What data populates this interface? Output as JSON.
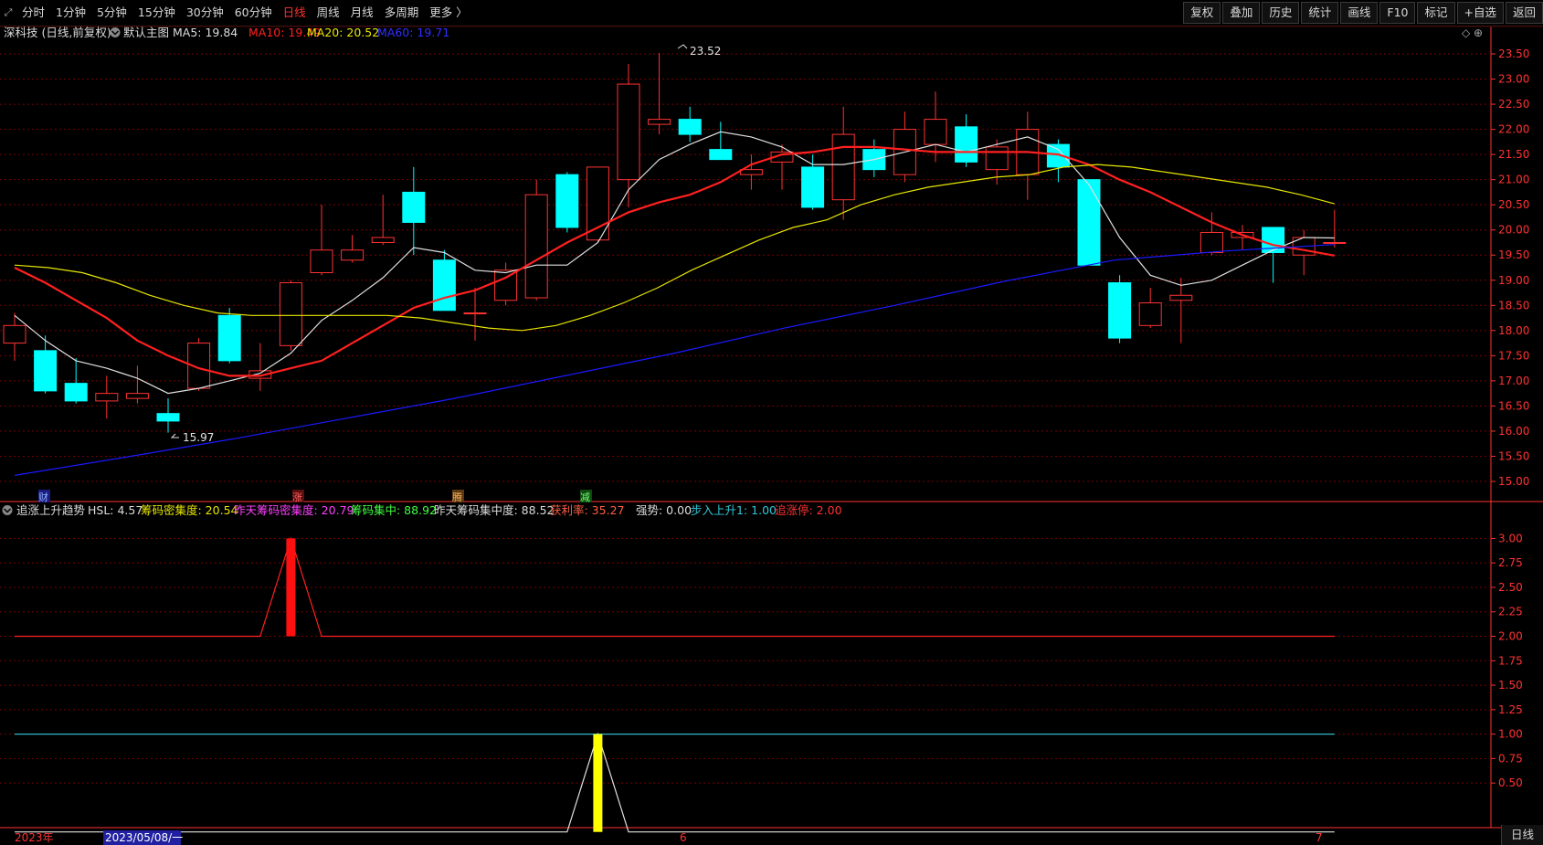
{
  "toolbar": {
    "left_items": [
      "分时",
      "1分钟",
      "5分钟",
      "15分钟",
      "30分钟",
      "60分钟",
      "日线",
      "周线",
      "月线",
      "多周期",
      "更多 〉"
    ],
    "active": "日线",
    "right_items": [
      "复权",
      "叠加",
      "历史",
      "统计",
      "画线",
      "F10",
      "标记",
      "+自选",
      "返回"
    ]
  },
  "main_header": {
    "stock": "深科技 (日线,前复权)",
    "chart_name": "默认主图",
    "ma5": "MA5: 19.84",
    "ma10": "MA10: 19.49",
    "ma20": "MA20: 20.52",
    "ma60": "MA60: 19.71",
    "right_icons": "◇ ⊕"
  },
  "sub_header": {
    "name": "追涨上升趋势",
    "hsl": "HSL: 4.57",
    "cmj": "筹码密集度: 20.54",
    "zt_cmj": "昨天筹码密集度: 20.79",
    "cmjz": "筹码集中: 88.92",
    "zt_cmjz": "昨天筹码集中度: 88.52",
    "hll": "获利率: 35.27",
    "qs": "强势: 0.00",
    "brss": "步入上升1: 1.00",
    "zzt": "追涨停: 2.00"
  },
  "markers": {
    "max_label": "23.52",
    "min_label": "15.97",
    "events": [
      "财",
      "涨",
      "腾",
      "减"
    ]
  },
  "x_labels": {
    "year": "2023年",
    "cursor_date": "2023/05/08/一",
    "m6": "6",
    "m7": "7"
  },
  "status": {
    "period": "日线"
  },
  "colors": {
    "up": "#ff3232",
    "down": "#00ffff",
    "ma5": "#e0e0e0",
    "ma10": "#ff2020",
    "ma20": "#e6e600",
    "ma60": "#1a1aff",
    "grid": "#7a0000",
    "axis": "#ff3232"
  },
  "chart_data": [
    {
      "type": "candlestick",
      "ylim": [
        14.8,
        23.7
      ],
      "y_ticks": [
        "23.50",
        "23.00",
        "22.50",
        "22.00",
        "21.50",
        "21.00",
        "20.50",
        "20.00",
        "19.50",
        "19.00",
        "18.50",
        "18.00",
        "17.50",
        "17.00",
        "16.50",
        "16.00",
        "15.50",
        "15.00"
      ],
      "candles": [
        {
          "o": 17.75,
          "h": 18.35,
          "l": 17.4,
          "c": 18.1
        },
        {
          "o": 17.6,
          "h": 17.9,
          "l": 16.75,
          "c": 16.8
        },
        {
          "o": 16.95,
          "h": 17.45,
          "l": 16.55,
          "c": 16.6
        },
        {
          "o": 16.6,
          "h": 17.1,
          "l": 16.25,
          "c": 16.75
        },
        {
          "o": 16.65,
          "h": 17.3,
          "l": 16.55,
          "c": 16.75
        },
        {
          "o": 16.35,
          "h": 16.65,
          "l": 15.97,
          "c": 16.2
        },
        {
          "o": 16.85,
          "h": 17.85,
          "l": 16.8,
          "c": 17.75
        },
        {
          "o": 18.3,
          "h": 18.45,
          "l": 17.35,
          "c": 17.4
        },
        {
          "o": 17.05,
          "h": 17.75,
          "l": 16.8,
          "c": 17.2
        },
        {
          "o": 17.7,
          "h": 19.0,
          "l": 17.6,
          "c": 18.95
        },
        {
          "o": 19.15,
          "h": 20.5,
          "l": 19.1,
          "c": 19.6
        },
        {
          "o": 19.4,
          "h": 19.9,
          "l": 19.35,
          "c": 19.6
        },
        {
          "o": 19.75,
          "h": 20.7,
          "l": 19.7,
          "c": 19.85
        },
        {
          "o": 20.75,
          "h": 21.25,
          "l": 19.5,
          "c": 20.15
        },
        {
          "o": 19.4,
          "h": 19.6,
          "l": 18.4,
          "c": 18.4
        },
        {
          "o": 18.35,
          "h": 18.85,
          "l": 17.8,
          "c": 18.35
        },
        {
          "o": 18.6,
          "h": 19.35,
          "l": 18.5,
          "c": 19.2
        },
        {
          "o": 18.65,
          "h": 21.0,
          "l": 18.6,
          "c": 20.7
        },
        {
          "o": 21.1,
          "h": 21.15,
          "l": 19.95,
          "c": 20.05
        },
        {
          "o": 19.8,
          "h": 21.25,
          "l": 19.75,
          "c": 21.25
        },
        {
          "o": 21.0,
          "h": 23.3,
          "l": 20.45,
          "c": 22.9
        },
        {
          "o": 22.1,
          "h": 23.52,
          "l": 21.9,
          "c": 22.2
        },
        {
          "o": 22.2,
          "h": 22.45,
          "l": 21.75,
          "c": 21.9
        },
        {
          "o": 21.6,
          "h": 22.15,
          "l": 21.4,
          "c": 21.4
        },
        {
          "o": 21.1,
          "h": 21.5,
          "l": 20.8,
          "c": 21.2
        },
        {
          "o": 21.35,
          "h": 21.7,
          "l": 20.8,
          "c": 21.55
        },
        {
          "o": 21.25,
          "h": 21.5,
          "l": 20.4,
          "c": 20.45
        },
        {
          "o": 20.6,
          "h": 22.45,
          "l": 20.2,
          "c": 21.9
        },
        {
          "o": 21.6,
          "h": 21.8,
          "l": 21.05,
          "c": 21.2
        },
        {
          "o": 21.1,
          "h": 22.35,
          "l": 20.95,
          "c": 22.0
        },
        {
          "o": 21.7,
          "h": 22.75,
          "l": 21.35,
          "c": 22.2
        },
        {
          "o": 22.05,
          "h": 22.3,
          "l": 21.25,
          "c": 21.35
        },
        {
          "o": 21.2,
          "h": 21.8,
          "l": 20.9,
          "c": 21.65
        },
        {
          "o": 21.1,
          "h": 22.35,
          "l": 20.6,
          "c": 22.0
        },
        {
          "o": 21.7,
          "h": 21.8,
          "l": 20.95,
          "c": 21.25
        },
        {
          "o": 21.0,
          "h": 21.0,
          "l": 19.3,
          "c": 19.3
        },
        {
          "o": 18.95,
          "h": 19.1,
          "l": 17.75,
          "c": 17.85
        },
        {
          "o": 18.1,
          "h": 18.85,
          "l": 18.05,
          "c": 18.55
        },
        {
          "o": 18.6,
          "h": 19.05,
          "l": 17.75,
          "c": 18.7
        },
        {
          "o": 19.55,
          "h": 20.35,
          "l": 19.5,
          "c": 19.95
        },
        {
          "o": 19.85,
          "h": 20.1,
          "l": 19.6,
          "c": 19.95
        },
        {
          "o": 20.05,
          "h": 20.05,
          "l": 18.95,
          "c": 19.55
        },
        {
          "o": 19.5,
          "h": 20.0,
          "l": 19.1,
          "c": 19.85
        },
        {
          "o": 19.75,
          "h": 20.4,
          "l": 19.65,
          "c": 19.75
        }
      ],
      "series": [
        {
          "name": "MA5",
          "values": [
            18.3,
            17.8,
            17.4,
            17.25,
            17.05,
            16.75,
            16.85,
            17.0,
            17.15,
            17.55,
            18.2,
            18.6,
            19.05,
            19.65,
            19.55,
            19.2,
            19.15,
            19.3,
            19.3,
            19.75,
            20.8,
            21.4,
            21.7,
            21.95,
            21.85,
            21.65,
            21.3,
            21.3,
            21.4,
            21.55,
            21.7,
            21.55,
            21.7,
            21.85,
            21.6,
            20.9,
            19.85,
            19.1,
            18.9,
            19.0,
            19.3,
            19.6,
            19.85,
            19.84
          ]
        },
        {
          "name": "MA10",
          "values": [
            19.25,
            18.95,
            18.6,
            18.25,
            17.8,
            17.5,
            17.25,
            17.1,
            17.1,
            17.25,
            17.4,
            17.75,
            18.1,
            18.45,
            18.65,
            18.8,
            19.05,
            19.4,
            19.75,
            20.05,
            20.35,
            20.55,
            20.7,
            20.95,
            21.3,
            21.5,
            21.55,
            21.65,
            21.65,
            21.6,
            21.55,
            21.55,
            21.55,
            21.55,
            21.5,
            21.3,
            21.0,
            20.75,
            20.45,
            20.15,
            19.9,
            19.7,
            19.6,
            19.49
          ]
        },
        {
          "name": "MA20",
          "values": [
            19.3,
            19.25,
            19.15,
            18.95,
            18.7,
            18.5,
            18.35,
            18.3,
            18.3,
            18.3,
            18.3,
            18.3,
            18.25,
            18.15,
            18.05,
            18.0,
            18.1,
            18.3,
            18.55,
            18.85,
            19.2,
            19.5,
            19.8,
            20.05,
            20.2,
            20.5,
            20.7,
            20.85,
            20.95,
            21.05,
            21.1,
            21.25,
            21.3,
            21.25,
            21.15,
            21.05,
            20.95,
            20.85,
            20.7,
            20.52
          ]
        },
        {
          "name": "MA60",
          "values": [
            15.12,
            15.48,
            15.85,
            16.25,
            16.65,
            17.1,
            17.55,
            18.05,
            18.5,
            18.98,
            19.4,
            19.58,
            19.71
          ]
        }
      ]
    },
    {
      "type": "line",
      "ylim": [
        0.1,
        3.2
      ],
      "y_ticks": [
        "3.00",
        "2.75",
        "2.50",
        "2.25",
        "2.00",
        "1.75",
        "1.50",
        "1.25",
        "1.00",
        "0.75",
        "0.50"
      ],
      "series": [
        {
          "name": "追涨停",
          "values": [
            2,
            2,
            2,
            2,
            2,
            2,
            2,
            2,
            2,
            3,
            2,
            2,
            2,
            2,
            2,
            2,
            2,
            2,
            2,
            2,
            2,
            2,
            2,
            2,
            2,
            2,
            2,
            2,
            2,
            2,
            2,
            2,
            2,
            2,
            2,
            2,
            2,
            2,
            2,
            2,
            2,
            2,
            2,
            2
          ]
        },
        {
          "name": "步入上升1",
          "values": [
            1,
            1,
            1,
            1,
            1,
            1,
            1,
            1,
            1,
            1,
            1,
            1,
            1,
            1,
            1,
            1,
            1,
            1,
            1,
            1,
            1,
            1,
            1,
            1,
            1,
            1,
            1,
            1,
            1,
            1,
            1,
            1,
            1,
            1,
            1,
            1,
            1,
            1,
            1,
            1,
            1,
            1,
            1,
            1
          ]
        },
        {
          "name": "强势",
          "values": [
            0,
            0,
            0,
            0,
            0,
            0,
            0,
            0,
            0,
            0,
            0,
            0,
            0,
            0,
            0,
            0,
            0,
            0,
            0,
            1,
            0,
            0,
            0,
            0,
            0,
            0,
            0,
            0,
            0,
            0,
            0,
            0,
            0,
            0,
            0,
            0,
            0,
            0,
            0,
            0,
            0,
            0,
            0,
            0
          ]
        }
      ]
    }
  ]
}
